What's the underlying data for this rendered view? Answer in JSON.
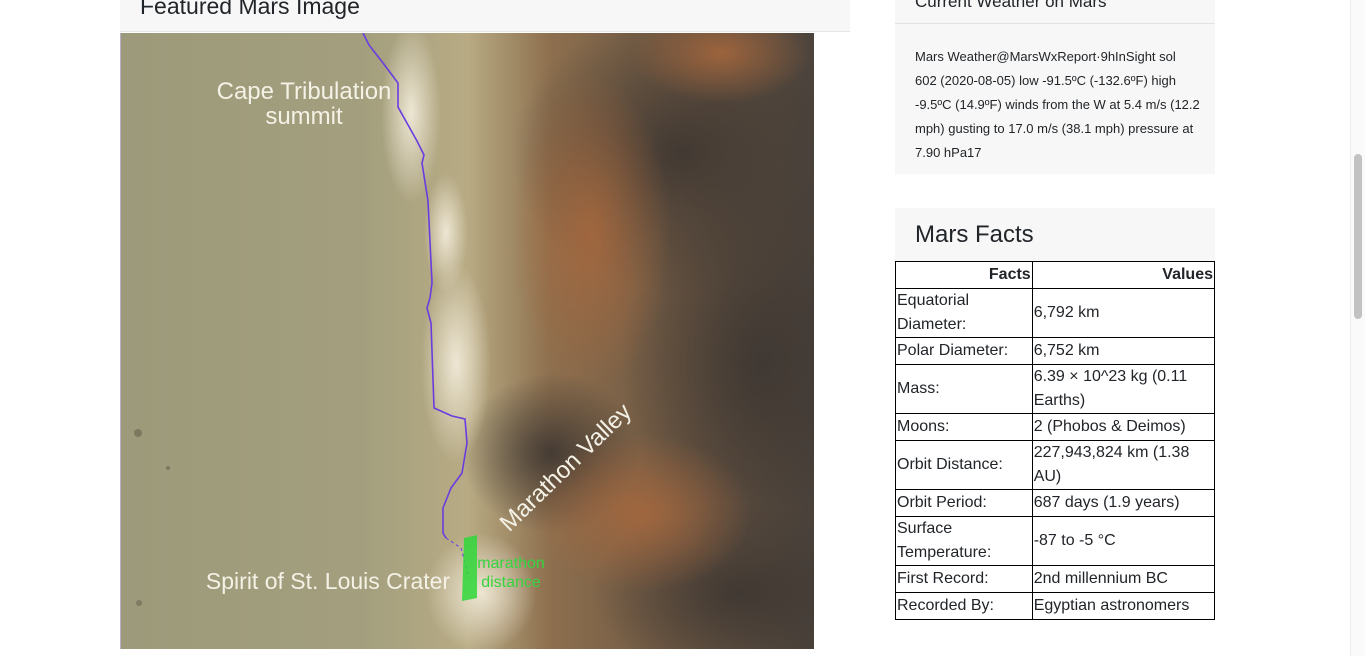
{
  "featured": {
    "title": "Featured Mars Image",
    "image_labels": {
      "cape": [
        "Cape Tribulation",
        "summit"
      ],
      "valley": "Marathon Valley",
      "crater": "Spirit of St. Louis Crater",
      "marathon": [
        "marathon",
        "distance"
      ]
    }
  },
  "weather": {
    "title": "Current Weather on Mars",
    "text": "Mars Weather@MarsWxReport·9hInSight sol 602 (2020-08-05) low -91.5ºC (-132.6ºF) high -9.5ºC (14.9ºF) winds from the W at 5.4 m/s (12.2 mph) gusting to 17.0 m/s (38.1 mph) pressure at 7.90 hPa17"
  },
  "facts": {
    "title": "Mars Facts",
    "headers": [
      "Facts",
      "Values"
    ],
    "rows": [
      [
        "Equatorial Diameter:",
        "6,792 km"
      ],
      [
        "Polar Diameter:",
        "6,752 km"
      ],
      [
        "Mass:",
        "6.39 × 10^23 kg (0.11 Earths)"
      ],
      [
        "Moons:",
        "2 (Phobos & Deimos)"
      ],
      [
        "Orbit Distance:",
        "227,943,824 km (1.38 AU)"
      ],
      [
        "Orbit Period:",
        "687 days (1.9 years)"
      ],
      [
        "Surface Temperature:",
        "-87 to -5 °C"
      ],
      [
        "First Record:",
        "2nd millennium BC"
      ],
      [
        "Recorded By:",
        "Egyptian astronomers"
      ]
    ]
  }
}
